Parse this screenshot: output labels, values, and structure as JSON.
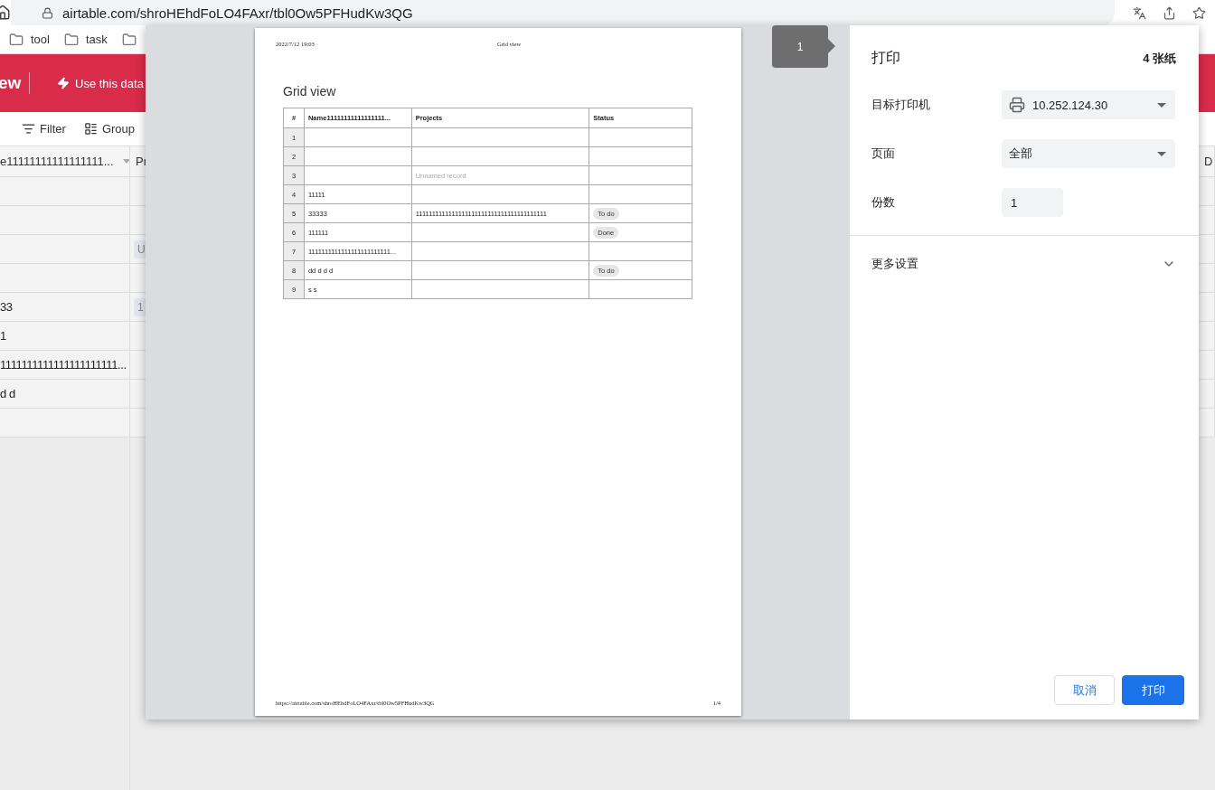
{
  "browser": {
    "url": "airtable.com/shroHEhdFoLO4FAxr/tbl0Ow5PFHudKw3QG",
    "bookmarks": [
      "tool",
      "task"
    ]
  },
  "app": {
    "header_title": "ew",
    "header_action": "Use this data",
    "toolbar": [
      "Filter",
      "Group"
    ],
    "grid": {
      "columns": [
        "e11111111111111111...",
        "Pr"
      ],
      "right_column": "D",
      "rows": [
        {},
        {},
        {
          "chip": "U"
        },
        {},
        {
          "name": "33",
          "chip": "1"
        },
        {
          "name": "1"
        },
        {
          "name": "1111111111111111111111..."
        },
        {
          "name": "d d"
        },
        {}
      ]
    }
  },
  "print_dialog": {
    "page_tab": "1",
    "preview": {
      "header_left": "2022/7/12 19:03",
      "header_center": "Grid view",
      "title": "Grid view",
      "columns": [
        "#",
        "Name11111111111111111...",
        "Projects",
        "Status"
      ],
      "rows": [
        {
          "number": "1"
        },
        {
          "number": "2"
        },
        {
          "number": "3",
          "project": "Unnamed record",
          "project_muted": true
        },
        {
          "number": "4",
          "name": "11111"
        },
        {
          "number": "5",
          "name": "33333",
          "project": "1111111111111111111111111111111111111111",
          "project_muted": false,
          "status": "To do"
        },
        {
          "number": "6",
          "name": "111111",
          "status": "Done"
        },
        {
          "number": "7",
          "name": "1111111111111111111111111..."
        },
        {
          "number": "8",
          "name": "dd d d d",
          "status": "To do"
        },
        {
          "number": "9",
          "name": "s s"
        }
      ],
      "footer_left": "https://airtable.com/shroHEhdFoLO4FAxr/tbl0Ow5PFHudKw3QG",
      "footer_right": "1/4"
    },
    "settings": {
      "title": "打印",
      "sheets": "4 张纸",
      "fields": [
        {
          "label": "目标打印机",
          "kind": "printer_select",
          "value": "10.252.124.30"
        },
        {
          "label": "页面",
          "kind": "select",
          "value": "全部"
        },
        {
          "label": "份数",
          "kind": "input",
          "value": "1"
        }
      ],
      "more": "更多设置",
      "cancel": "取消",
      "print": "打印"
    }
  }
}
